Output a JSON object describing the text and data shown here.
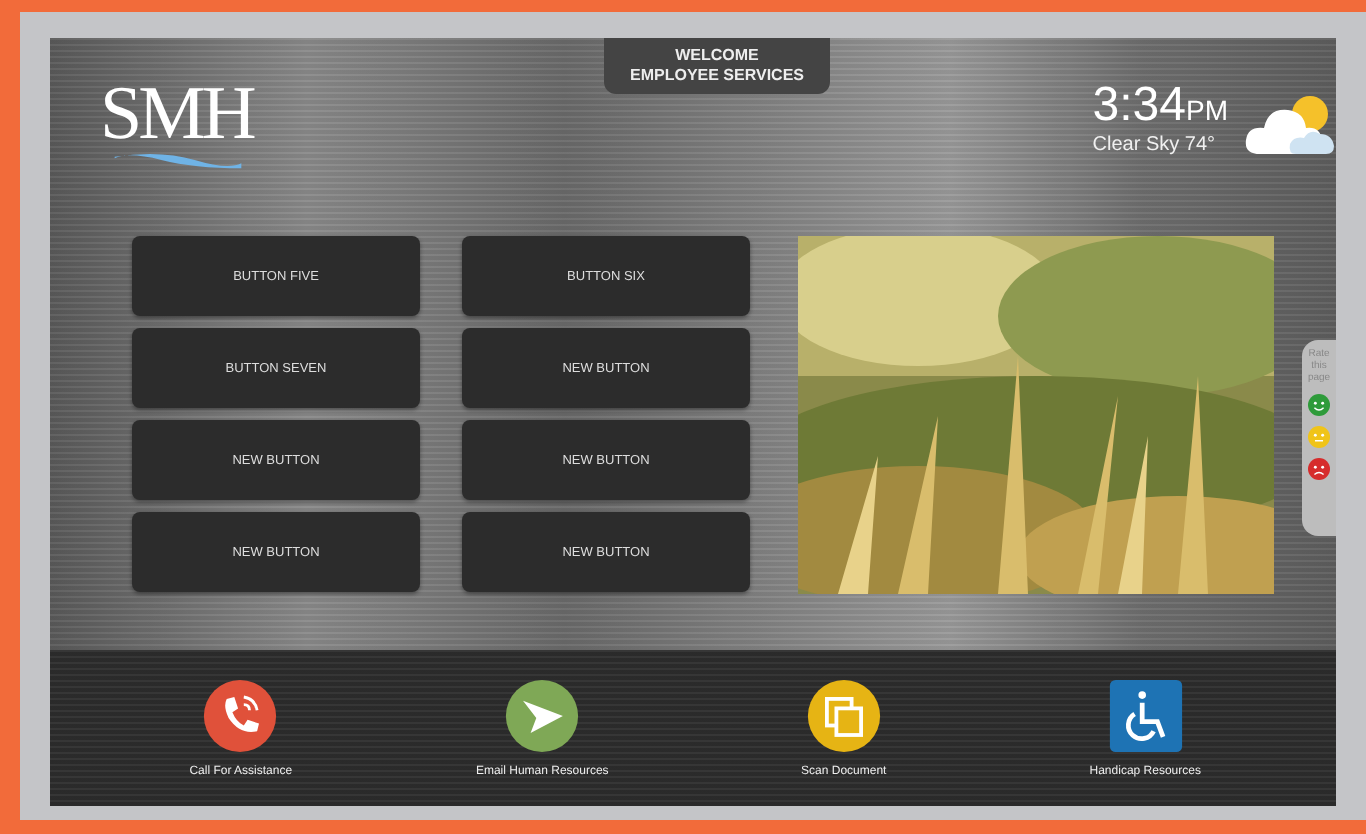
{
  "header": {
    "logo": "SMH",
    "welcome": [
      "WELCOME",
      "EMPLOYEE SERVICES"
    ],
    "time": "3:34",
    "meridiem": "PM",
    "weather": "Clear Sky 74°"
  },
  "buttons": [
    "BUTTON FIVE",
    "BUTTON SIX",
    "BUTTON SEVEN",
    "NEW BUTTON",
    "NEW BUTTON",
    "NEW BUTTON",
    "NEW BUTTON",
    "NEW BUTTON"
  ],
  "feedback": {
    "label": "Rate this page",
    "faces": [
      {
        "kind": "happy",
        "color": "#2e9b3a"
      },
      {
        "kind": "neutral",
        "color": "#f0c419"
      },
      {
        "kind": "sad",
        "color": "#d62c2c"
      }
    ]
  },
  "actions": [
    {
      "kind": "phone",
      "label": "Call For Assistance",
      "color": "#e0513a"
    },
    {
      "kind": "send",
      "label": "Email Human Resources",
      "color": "#7fa856"
    },
    {
      "kind": "copy",
      "label": "Scan Document",
      "color": "#e6b414"
    },
    {
      "kind": "wheelchair",
      "label": "Handicap Resources",
      "color": "#1e73b4"
    }
  ]
}
